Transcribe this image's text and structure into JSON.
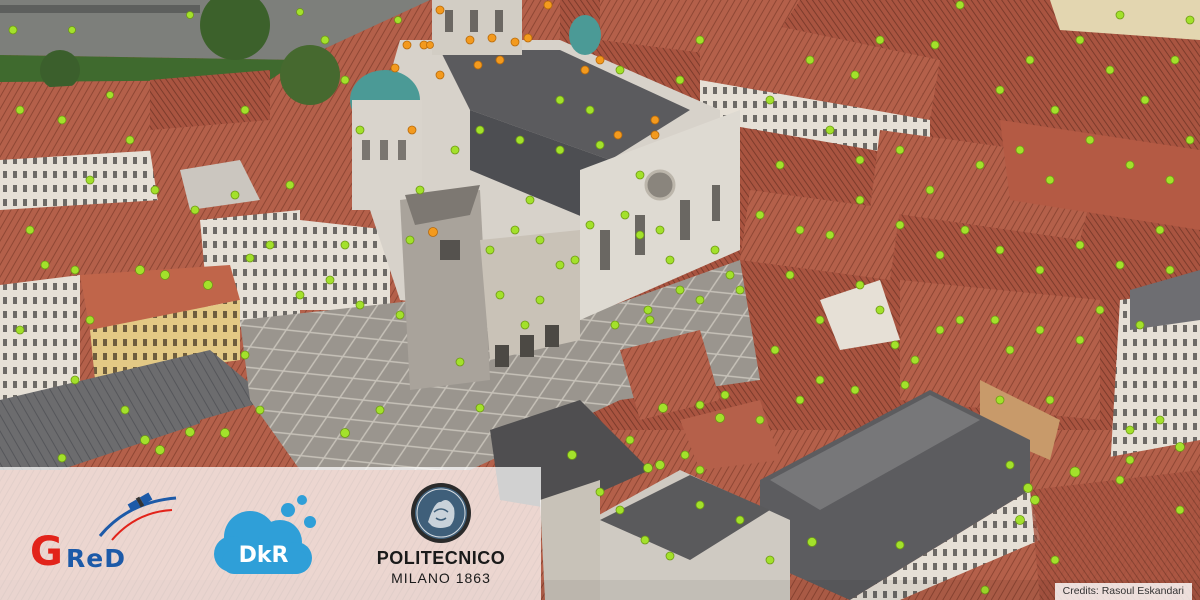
{
  "image": {
    "subject": "aerial-3d-city-view",
    "marker_colors": {
      "primary": "#9be22a",
      "secondary": "#f39a1e"
    },
    "roof_color": "#b35b43",
    "stone_color": "#d9d4cc"
  },
  "logos": {
    "gred": {
      "g": "G",
      "red": "ReD"
    },
    "dkr": {
      "text": "DkR"
    },
    "polimi": {
      "name": "POLITECNICO",
      "sub": "MILANO 1863"
    }
  },
  "credits": "Credits: Rasoul Eskandari"
}
